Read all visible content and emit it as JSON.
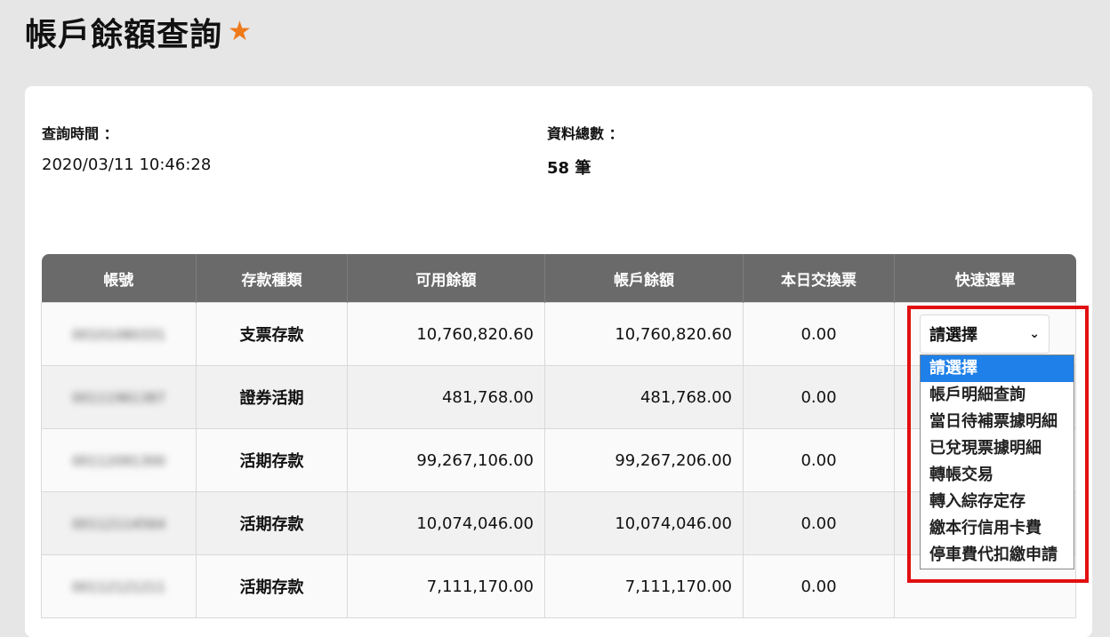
{
  "title": "帳戶餘額查詢",
  "query_time": {
    "label": "查詢時間 ：",
    "value": "2020/03/11 10:46:28"
  },
  "total_count": {
    "label": "資料總數 ：",
    "value": "58 筆"
  },
  "table": {
    "headers": [
      "帳號",
      "存款種類",
      "可用餘額",
      "帳戶餘額",
      "本日交換票",
      "快速選單"
    ],
    "rows": [
      {
        "account": "00101080331",
        "type": "支票存款",
        "available": "10,760,820.60",
        "balance": "10,760,820.60",
        "exchange": "0.00",
        "menu": "請選擇"
      },
      {
        "account": "00111961387",
        "type": "證券活期",
        "available": "481,768.00",
        "balance": "481,768.00",
        "exchange": "0.00",
        "menu": ""
      },
      {
        "account": "00112091300",
        "type": "活期存款",
        "available": "99,267,106.00",
        "balance": "99,267,206.00",
        "exchange": "0.00",
        "menu": ""
      },
      {
        "account": "00112114564",
        "type": "活期存款",
        "available": "10,074,046.00",
        "balance": "10,074,046.00",
        "exchange": "0.00",
        "menu": ""
      },
      {
        "account": "00112121211",
        "type": "活期存款",
        "available": "7,111,170.00",
        "balance": "7,111,170.00",
        "exchange": "0.00",
        "menu": ""
      }
    ]
  },
  "dropdown": {
    "options": [
      "請選擇",
      "帳戶明細查詢",
      "當日待補票據明細",
      "已兌現票據明細",
      "轉帳交易",
      "轉入綜存定存",
      "繳本行信用卡費",
      "停車費代扣繳申請"
    ],
    "selected_index": 0
  },
  "colors": {
    "star": "#ee7a1a",
    "header_bg": "#6a6a6a",
    "selected_option": "#1e80e8",
    "highlight": "#e20f0f"
  }
}
